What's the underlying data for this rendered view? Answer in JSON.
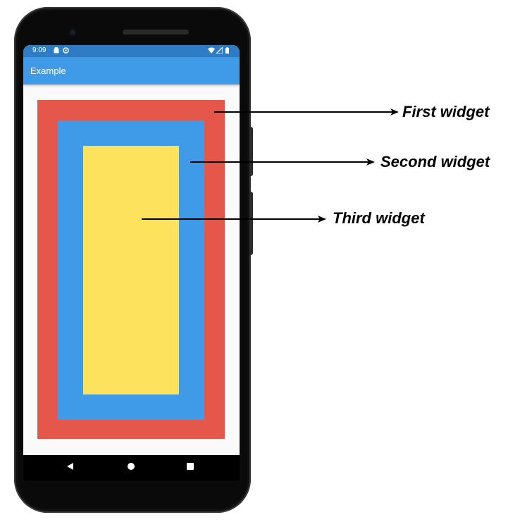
{
  "status_bar": {
    "time": "9:09",
    "icons": [
      "clipboard-icon",
      "sync-icon",
      "wifi-icon",
      "signal-icon",
      "battery-icon"
    ]
  },
  "app_bar": {
    "title": "Example"
  },
  "widgets": [
    {
      "name": "first",
      "color": "#e5574a"
    },
    {
      "name": "second",
      "color": "#3f9ae8"
    },
    {
      "name": "third",
      "color": "#fde35d"
    }
  ],
  "annotations": {
    "first": "First widget",
    "second": "Second widget",
    "third": "Third widget"
  },
  "nav_bar": {
    "icons": [
      "back-icon",
      "home-icon",
      "recents-icon"
    ]
  },
  "colors": {
    "status_bar": "#2d7cc4",
    "app_bar": "#3f9ae8",
    "screen_background": "#fafafa",
    "phone_body": "#0a0a0a"
  }
}
